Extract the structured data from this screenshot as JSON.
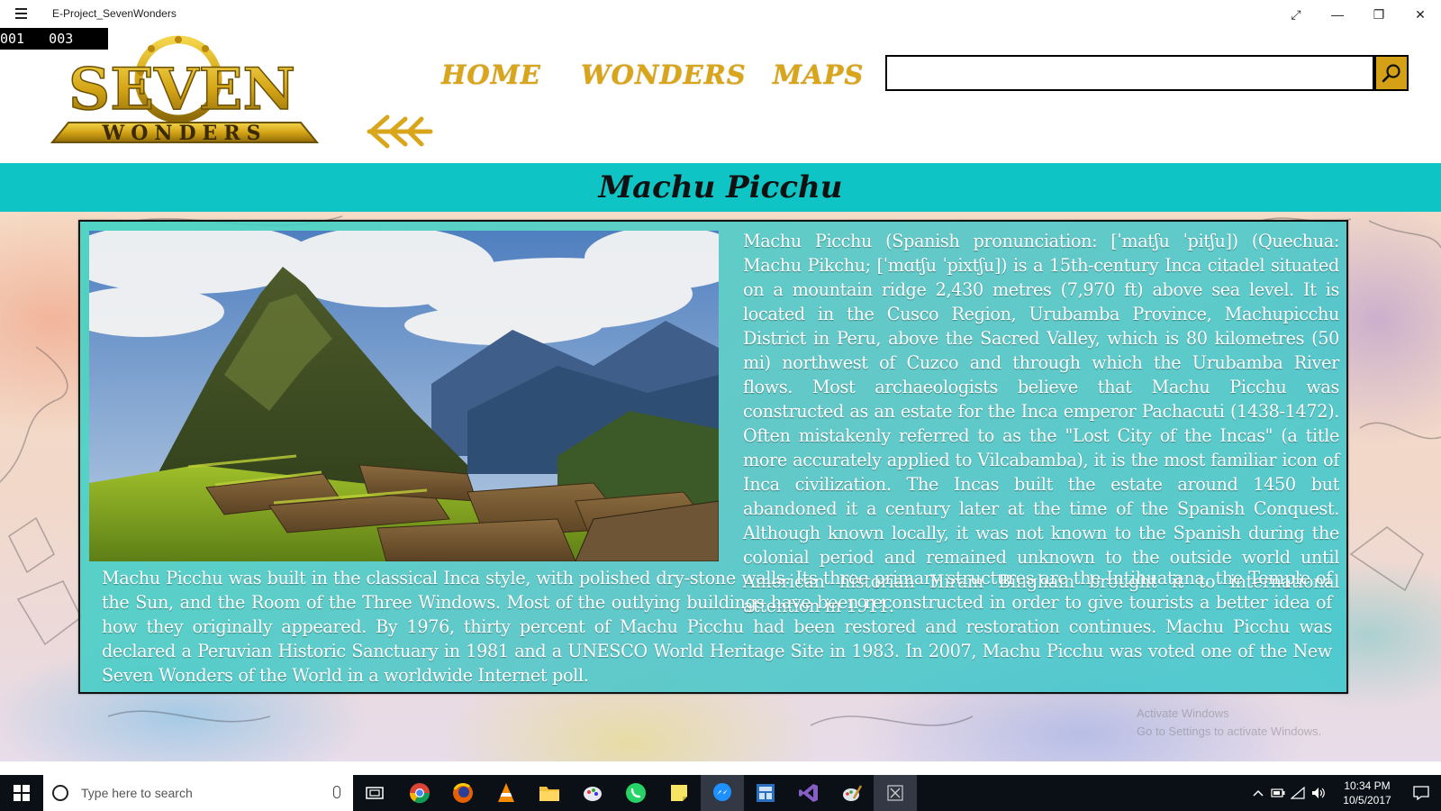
{
  "window": {
    "title": "E-Project_SevenWonders",
    "expand_glyph": "⤢",
    "minimize_glyph": "—",
    "maximize_glyph": "❐",
    "close_glyph": "✕"
  },
  "frame_counter": "001   003",
  "logo": {
    "line1": "SEVEN",
    "line2": "WONDERS"
  },
  "nav": {
    "home": "HOME",
    "wonders": "WONDERS",
    "maps": "MAPS"
  },
  "search": {
    "placeholder": "",
    "value": "",
    "icon": "search-icon"
  },
  "page": {
    "title": "Machu Picchu",
    "paragraph1": "Machu Picchu (Spanish pronunciation: [ˈmatʃu ˈpitʃu]) (Quechua: Machu Pikchu; [ˈmɑtʃu ˈpixtʃu]) is a 15th-century Inca citadel situated on a mountain ridge 2,430 metres (7,970 ft) above sea level. It is located in the Cusco Region, Urubamba Province, Machupicchu District in Peru, above the Sacred Valley, which is 80 kilometres (50 mi) northwest of Cuzco and through which the Urubamba River flows. Most archaeologists believe that Machu Picchu was constructed as an estate for the Inca emperor Pachacuti (1438-1472). Often mistakenly referred to as the \"Lost City of the Incas\" (a title more accurately applied to Vilcabamba), it is the most familiar icon of Inca civilization. The Incas built the estate around 1450 but abandoned it a century later at the time of the Spanish Conquest. Although known locally, it was not known to the Spanish during the colonial period and remained unknown to the outside world until American historian Hiram Bingham brought it to international attention in 1911.",
    "paragraph2": "Machu Picchu was built in the classical Inca style, with polished dry-stone walls. Its three primary structures are the Intihuatana, the Temple of the Sun, and the Room of the Three Windows. Most of the outlying buildings have been reconstructed in order to give tourists a better idea of how they originally appeared. By 1976, thirty percent of Machu Picchu had been restored and restoration continues. Machu Picchu was declared a Peruvian Historic Sanctuary in 1981 and a UNESCO World Heritage Site in 1983. In 2007, Machu Picchu was voted one of the New Seven Wonders of the World in a worldwide Internet poll."
  },
  "watermark": {
    "line1": "Activate Windows",
    "line2": "Go to Settings to activate Windows."
  },
  "taskbar": {
    "search_placeholder": "Type here to search",
    "time": "10:34 PM",
    "date": "10/5/2017",
    "apps": [
      "chrome-icon",
      "firefox-icon",
      "vlc-icon",
      "file-explorer-icon",
      "paint-icon",
      "whatsapp-icon",
      "sticky-notes-icon",
      "messenger-icon",
      "calculator-icon",
      "visual-studio-icon",
      "paint-brush-icon",
      "close-app-icon"
    ]
  },
  "colors": {
    "accent_gold": "#d9a61b",
    "banner_teal": "#0ec4c4",
    "card_teal": "#3ad4c4"
  }
}
